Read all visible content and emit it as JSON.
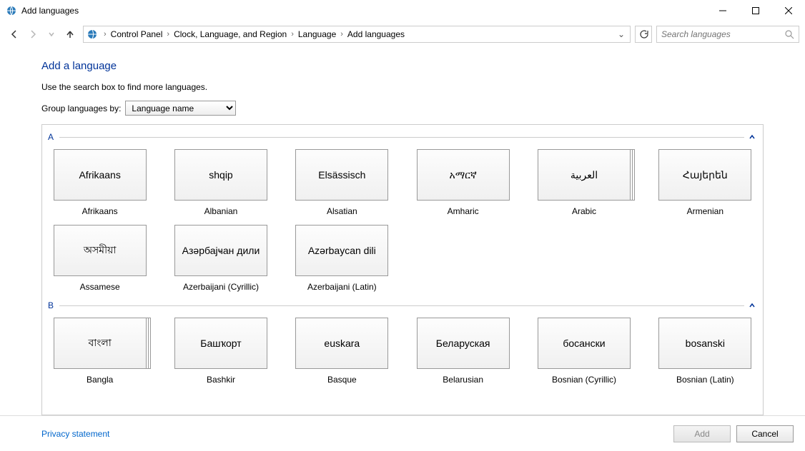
{
  "window": {
    "title": "Add languages"
  },
  "breadcrumb": {
    "items": [
      "Control Panel",
      "Clock, Language, and Region",
      "Language",
      "Add languages"
    ]
  },
  "search": {
    "placeholder": "Search languages"
  },
  "page": {
    "title": "Add a language",
    "instruction": "Use the search box to find more languages.",
    "group_label": "Group languages by:",
    "group_value": "Language name"
  },
  "groups": [
    {
      "letter": "A",
      "items": [
        {
          "native": "Afrikaans",
          "name": "Afrikaans",
          "multi": false
        },
        {
          "native": "shqip",
          "name": "Albanian",
          "multi": false
        },
        {
          "native": "Elsässisch",
          "name": "Alsatian",
          "multi": false
        },
        {
          "native": "አማርኛ",
          "name": "Amharic",
          "multi": false
        },
        {
          "native": "العربية",
          "name": "Arabic",
          "multi": true
        },
        {
          "native": "Հայերեն",
          "name": "Armenian",
          "multi": false
        },
        {
          "native": "অসমীয়া",
          "name": "Assamese",
          "multi": false
        },
        {
          "native": "Азәрбајҹан дили",
          "name": "Azerbaijani (Cyrillic)",
          "multi": false
        },
        {
          "native": "Azərbaycan dili",
          "name": "Azerbaijani (Latin)",
          "multi": false
        }
      ]
    },
    {
      "letter": "B",
      "items": [
        {
          "native": "বাংলা",
          "name": "Bangla",
          "multi": true
        },
        {
          "native": "Башҡорт",
          "name": "Bashkir",
          "multi": false
        },
        {
          "native": "euskara",
          "name": "Basque",
          "multi": false
        },
        {
          "native": "Беларуская",
          "name": "Belarusian",
          "multi": false
        },
        {
          "native": "босански",
          "name": "Bosnian (Cyrillic)",
          "multi": false
        },
        {
          "native": "bosanski",
          "name": "Bosnian (Latin)",
          "multi": false
        }
      ]
    }
  ],
  "footer": {
    "privacy": "Privacy statement",
    "add": "Add",
    "cancel": "Cancel"
  }
}
